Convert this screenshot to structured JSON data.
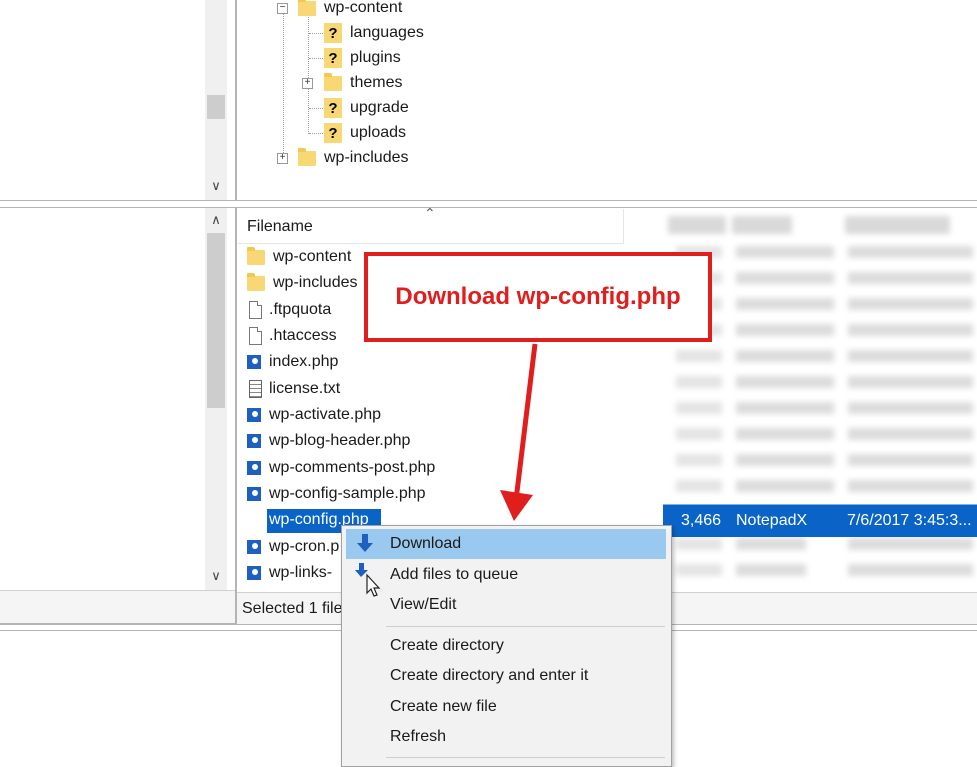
{
  "tree": {
    "items": [
      {
        "label": "wp-content",
        "kind": "folder"
      },
      {
        "label": "languages",
        "kind": "unknown"
      },
      {
        "label": "plugins",
        "kind": "unknown"
      },
      {
        "label": "themes",
        "kind": "folder"
      },
      {
        "label": "upgrade",
        "kind": "unknown"
      },
      {
        "label": "uploads",
        "kind": "unknown"
      },
      {
        "label": "wp-includes",
        "kind": "folder"
      }
    ]
  },
  "filelist": {
    "column_header": "Filename",
    "files": [
      {
        "name": "wp-content",
        "type": "folder"
      },
      {
        "name": "wp-includes",
        "type": "folder"
      },
      {
        "name": ".ftpquota",
        "type": "doc"
      },
      {
        "name": ".htaccess",
        "type": "doc"
      },
      {
        "name": "index.php",
        "type": "php"
      },
      {
        "name": "license.txt",
        "type": "txt"
      },
      {
        "name": "wp-activate.php",
        "type": "php"
      },
      {
        "name": "wp-blog-header.php",
        "type": "php"
      },
      {
        "name": "wp-comments-post.php",
        "type": "php"
      },
      {
        "name": "wp-config-sample.php",
        "type": "php"
      },
      {
        "name": "wp-config.php",
        "type": "php"
      },
      {
        "name": "wp-cron.p",
        "type": "php"
      },
      {
        "name": "wp-links-",
        "type": "php"
      }
    ],
    "selected": {
      "size": "3,466",
      "type": "NotepadX",
      "modified": "7/6/2017 3:45:3..."
    },
    "status": "Selected 1 file"
  },
  "callout": {
    "text": "Download wp-config.php"
  },
  "menu": {
    "items": [
      "Download",
      "Add files to queue",
      "View/Edit",
      "Create directory",
      "Create directory and enter it",
      "Create new file",
      "Refresh"
    ]
  },
  "colors": {
    "selection": "#0a64c8",
    "menu_highlight": "#99c9ef",
    "callout": "#e01e1e"
  }
}
